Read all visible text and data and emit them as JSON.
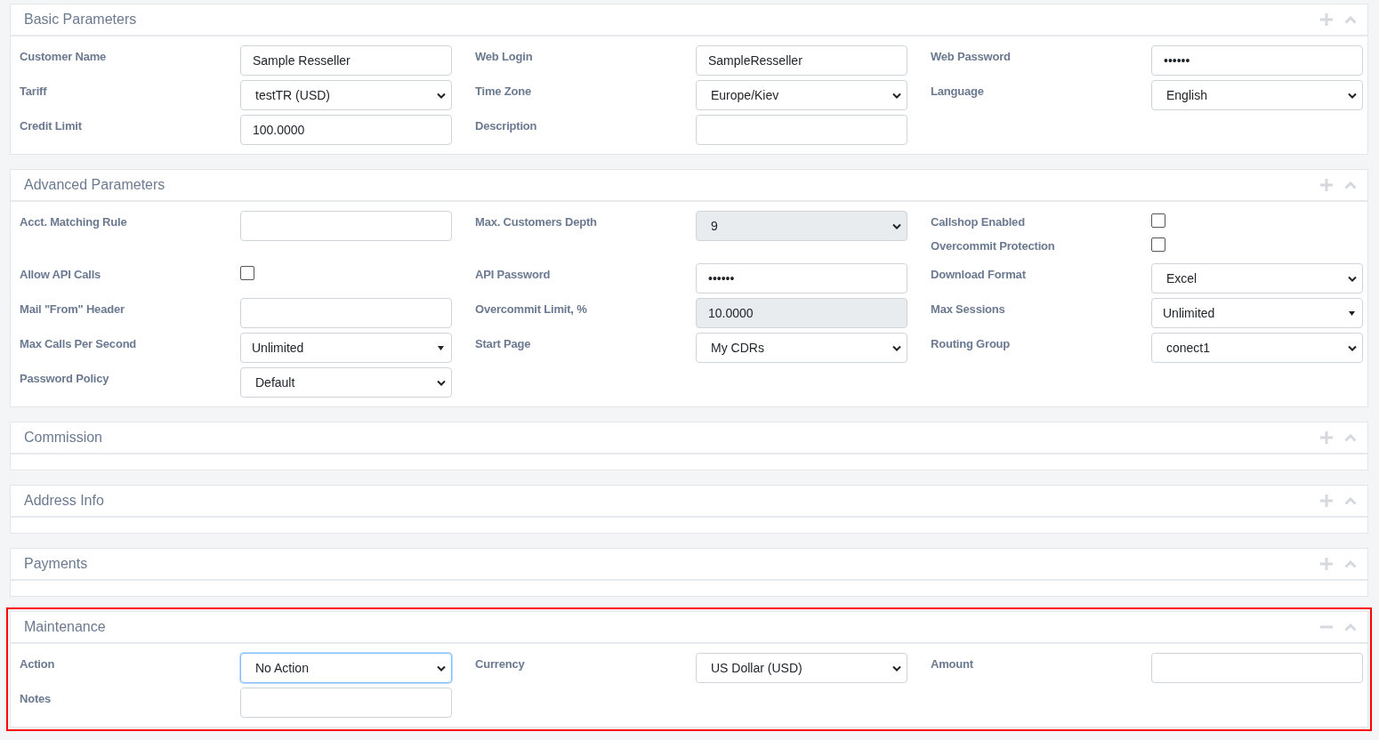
{
  "panels": [
    {
      "title": "Basic Parameters",
      "expanded": false,
      "highlighted": false,
      "rows": [
        [
          [
            {
              "kind": "text",
              "label": "Customer Name",
              "value": "Sample Resseller"
            }
          ],
          [
            {
              "kind": "text",
              "label": "Web Login",
              "value": "SampleResseller"
            }
          ],
          [
            {
              "kind": "password",
              "label": "Web Password",
              "value": "••••••"
            }
          ]
        ],
        [
          [
            {
              "kind": "select",
              "label": "Tariff",
              "value": "testTR (USD)"
            }
          ],
          [
            {
              "kind": "select",
              "label": "Time Zone",
              "value": "Europe/Kiev"
            }
          ],
          [
            {
              "kind": "select",
              "label": "Language",
              "value": "English"
            }
          ]
        ],
        [
          [
            {
              "kind": "text",
              "label": "Credit Limit",
              "value": "100.0000"
            }
          ],
          [
            {
              "kind": "text",
              "label": "Description"
            }
          ]
        ]
      ]
    },
    {
      "title": "Advanced Parameters",
      "expanded": false,
      "highlighted": false,
      "rows": [
        [
          [
            {
              "kind": "text",
              "label": "Acct. Matching Rule"
            }
          ],
          [
            {
              "kind": "select",
              "label": "Max. Customers Depth",
              "value": "9",
              "disabled": true
            }
          ],
          [
            {
              "kind": "checkbox",
              "label": "Callshop Enabled",
              "checked": false
            },
            {
              "kind": "checkbox",
              "label": "Overcommit Protection",
              "checked": false
            }
          ]
        ],
        [
          [
            {
              "kind": "checkbox",
              "label": "Allow API Calls",
              "checked": false
            }
          ],
          [
            {
              "kind": "password",
              "label": "API Password",
              "value": "••••••"
            }
          ],
          [
            {
              "kind": "select",
              "label": "Download Format",
              "value": "Excel"
            }
          ]
        ],
        [
          [
            {
              "kind": "text",
              "label": "Mail \"From\" Header"
            }
          ],
          [
            {
              "kind": "text",
              "label": "Overcommit Limit, %",
              "value": "10.0000",
              "disabled": true
            }
          ],
          [
            {
              "kind": "combo",
              "label": "Max Sessions",
              "value": "Unlimited"
            }
          ]
        ],
        [
          [
            {
              "kind": "combo",
              "label": "Max Calls Per Second",
              "value": "Unlimited"
            }
          ],
          [
            {
              "kind": "select",
              "label": "Start Page",
              "value": "My CDRs"
            }
          ],
          [
            {
              "kind": "select",
              "label": "Routing Group",
              "value": "conect1"
            }
          ]
        ],
        [
          [
            {
              "kind": "select",
              "label": "Password Policy",
              "value": "Default"
            }
          ]
        ]
      ]
    },
    {
      "title": "Commission",
      "expanded": false,
      "highlighted": false
    },
    {
      "title": "Address Info",
      "expanded": false,
      "highlighted": false
    },
    {
      "title": "Payments",
      "expanded": false,
      "highlighted": false
    },
    {
      "title": "Maintenance",
      "expanded": true,
      "highlighted": true,
      "rows": [
        [
          [
            {
              "kind": "select",
              "label": "Action",
              "value": "No Action",
              "focused": true
            }
          ],
          [
            {
              "kind": "select",
              "label": "Currency",
              "value": "US Dollar (USD)"
            }
          ],
          [
            {
              "kind": "text",
              "label": "Amount"
            }
          ]
        ],
        [
          [
            {
              "kind": "text",
              "label": "Notes"
            }
          ]
        ]
      ]
    }
  ]
}
